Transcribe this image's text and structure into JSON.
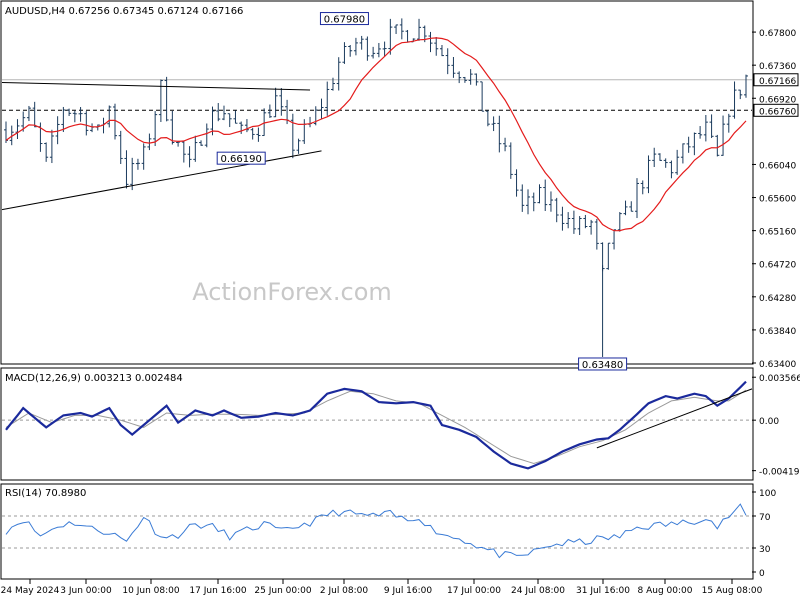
{
  "chart_data": [
    {
      "type": "candlestick",
      "panel": "price",
      "title": "AUDUSD,H4  0.67256 0.67345 0.67124 0.67166",
      "watermark": "ActionForex.com",
      "ylim": [
        0.634,
        0.682
      ],
      "yticks": [
        "0.67800",
        "0.67360",
        "0.66920",
        "0.66040",
        "0.65600",
        "0.65160",
        "0.64720",
        "0.64280",
        "0.63840",
        "0.63400"
      ],
      "last_price_label": "0.67166",
      "last_price": 0.67166,
      "level_line_label": "0.66760",
      "level_line": 0.6676,
      "annotations": [
        {
          "text": "0.67980",
          "x": 59,
          "y": 0.6798
        },
        {
          "text": "0.66190",
          "x": 41,
          "y": 0.6619
        },
        {
          "text": "0.63480",
          "x": 104,
          "y": 0.6348
        }
      ],
      "moving_average": {
        "name": "",
        "color": "#e41c1c"
      },
      "trendlines": [
        {
          "p1": [
            0,
            0.6713
          ],
          "p2": [
            53,
            0.6703
          ]
        },
        {
          "p1": [
            0,
            0.6544
          ],
          "p2": [
            55,
            0.6622
          ]
        }
      ],
      "price_path": [
        [
          0,
          0.665
        ],
        [
          4,
          0.667
        ],
        [
          7,
          0.6605
        ],
        [
          10,
          0.668
        ],
        [
          13,
          0.667
        ],
        [
          16,
          0.6645
        ],
        [
          18,
          0.668
        ],
        [
          21,
          0.6585
        ],
        [
          24,
          0.6615
        ],
        [
          27,
          0.6705
        ],
        [
          29,
          0.6645
        ],
        [
          32,
          0.66
        ],
        [
          35,
          0.6665
        ],
        [
          38,
          0.6675
        ],
        [
          41,
          0.6645
        ],
        [
          44,
          0.6655
        ],
        [
          47,
          0.669
        ],
        [
          50,
          0.663
        ],
        [
          53,
          0.6655
        ],
        [
          56,
          0.67
        ],
        [
          58,
          0.674
        ],
        [
          61,
          0.6765
        ],
        [
          64,
          0.676
        ],
        [
          67,
          0.6775
        ],
        [
          70,
          0.678
        ],
        [
          73,
          0.6785
        ],
        [
          75,
          0.676
        ],
        [
          78,
          0.6735
        ],
        [
          81,
          0.672
        ],
        [
          84,
          0.666
        ],
        [
          87,
          0.662
        ],
        [
          90,
          0.6545
        ],
        [
          93,
          0.656
        ],
        [
          96,
          0.6545
        ],
        [
          99,
          0.652
        ],
        [
          102,
          0.6525
        ],
        [
          104,
          0.6455
        ],
        [
          106,
          0.652
        ],
        [
          108,
          0.6535
        ],
        [
          110,
          0.657
        ],
        [
          113,
          0.661
        ],
        [
          116,
          0.66
        ],
        [
          119,
          0.663
        ],
        [
          122,
          0.665
        ],
        [
          124,
          0.661
        ],
        [
          126,
          0.668
        ],
        [
          128,
          0.6705
        ],
        [
          129,
          0.672
        ]
      ],
      "x_labels": [
        "24 May 2024",
        "3 Jun 00:00",
        "10 Jun 08:00",
        "17 Jun 16:00",
        "25 Jun 00:00",
        "2 Jul 08:00",
        "9 Jul 16:00",
        "17 Jul 00:00",
        "24 Jul 08:00",
        "31 Jul 16:00",
        "8 Aug 00:00",
        "15 Aug 08:00"
      ]
    },
    {
      "type": "line",
      "panel": "macd",
      "title": "MACD(12,26,9)  0.003213  0.002484",
      "ylim": [
        -0.0048,
        0.004
      ],
      "yticks": [
        "0.003566",
        "0.00",
        "-0.00419"
      ],
      "series": [
        {
          "name": "",
          "color": "#1b2a9c",
          "values": [
            [
              0,
              -0.0008
            ],
            [
              3,
              0.001
            ],
            [
              7,
              -0.0006
            ],
            [
              10,
              0.0004
            ],
            [
              13,
              0.0006
            ],
            [
              15,
              0.0003
            ],
            [
              18,
              0.001
            ],
            [
              20,
              -0.0004
            ],
            [
              22,
              -0.0012
            ],
            [
              25,
              0.0
            ],
            [
              28,
              0.0012
            ],
            [
              30,
              -0.0002
            ],
            [
              33,
              0.0008
            ],
            [
              36,
              0.0004
            ],
            [
              38,
              0.0008
            ],
            [
              41,
              0.0002
            ],
            [
              44,
              0.0003
            ],
            [
              47,
              0.0006
            ],
            [
              50,
              0.0004
            ],
            [
              53,
              0.0008
            ],
            [
              56,
              0.0022
            ],
            [
              59,
              0.0026
            ],
            [
              62,
              0.0024
            ],
            [
              65,
              0.0015
            ],
            [
              68,
              0.0014
            ],
            [
              71,
              0.0015
            ],
            [
              74,
              0.0012
            ],
            [
              76,
              -0.0004
            ],
            [
              79,
              -0.0008
            ],
            [
              82,
              -0.0014
            ],
            [
              85,
              -0.0026
            ],
            [
              88,
              -0.0036
            ],
            [
              91,
              -0.004
            ],
            [
              94,
              -0.0034
            ],
            [
              97,
              -0.0026
            ],
            [
              100,
              -0.002
            ],
            [
              103,
              -0.0016
            ],
            [
              105,
              -0.0015
            ],
            [
              107,
              -0.0008
            ],
            [
              110,
              0.0005
            ],
            [
              112,
              0.0014
            ],
            [
              115,
              0.002
            ],
            [
              117,
              0.0018
            ],
            [
              120,
              0.0022
            ],
            [
              122,
              0.002
            ],
            [
              124,
              0.0012
            ],
            [
              126,
              0.0018
            ],
            [
              129,
              0.0032
            ]
          ]
        },
        {
          "name": "",
          "color": "#9a9a9a",
          "values": [
            [
              0,
              -0.0006
            ],
            [
              4,
              0.0006
            ],
            [
              8,
              -0.0002
            ],
            [
              12,
              0.0004
            ],
            [
              16,
              0.0004
            ],
            [
              20,
              0.0
            ],
            [
              24,
              -0.0006
            ],
            [
              28,
              0.0006
            ],
            [
              32,
              0.0004
            ],
            [
              36,
              0.0005
            ],
            [
              40,
              0.0005
            ],
            [
              44,
              0.0004
            ],
            [
              48,
              0.0005
            ],
            [
              52,
              0.0006
            ],
            [
              56,
              0.0016
            ],
            [
              60,
              0.0024
            ],
            [
              64,
              0.0022
            ],
            [
              68,
              0.0016
            ],
            [
              72,
              0.0014
            ],
            [
              76,
              0.0004
            ],
            [
              80,
              -0.0006
            ],
            [
              84,
              -0.0018
            ],
            [
              88,
              -0.003
            ],
            [
              92,
              -0.0036
            ],
            [
              96,
              -0.003
            ],
            [
              100,
              -0.0022
            ],
            [
              104,
              -0.0017
            ],
            [
              108,
              -0.0008
            ],
            [
              112,
              0.0006
            ],
            [
              116,
              0.0016
            ],
            [
              120,
              0.0019
            ],
            [
              124,
              0.0016
            ],
            [
              126,
              0.0016
            ],
            [
              129,
              0.0025
            ]
          ]
        }
      ],
      "trendline": {
        "p1": [
          103,
          -0.0023
        ],
        "p2": [
          129,
          0.0026
        ]
      }
    },
    {
      "type": "line",
      "panel": "rsi",
      "title": "RSI(14) 70.8980",
      "ylim": [
        0,
        100
      ],
      "yticks": [
        "100",
        "70",
        "30",
        "0"
      ],
      "series": [
        {
          "name": "",
          "color": "#3a7bd5",
          "values": [
            [
              0,
              52
            ],
            [
              3,
              66
            ],
            [
              6,
              45
            ],
            [
              9,
              58
            ],
            [
              12,
              62
            ],
            [
              15,
              54
            ],
            [
              18,
              50
            ],
            [
              21,
              38
            ],
            [
              24,
              70
            ],
            [
              26,
              52
            ],
            [
              28,
              42
            ],
            [
              30,
              47
            ],
            [
              33,
              60
            ],
            [
              36,
              56
            ],
            [
              39,
              45
            ],
            [
              42,
              52
            ],
            [
              45,
              60
            ],
            [
              48,
              50
            ],
            [
              51,
              58
            ],
            [
              54,
              64
            ],
            [
              56,
              72
            ],
            [
              58,
              75
            ],
            [
              61,
              72
            ],
            [
              64,
              70
            ],
            [
              67,
              72
            ],
            [
              70,
              64
            ],
            [
              72,
              70
            ],
            [
              74,
              55
            ],
            [
              77,
              45
            ],
            [
              80,
              40
            ],
            [
              83,
              30
            ],
            [
              86,
              22
            ],
            [
              89,
              18
            ],
            [
              92,
              25
            ],
            [
              95,
              34
            ],
            [
              98,
              36
            ],
            [
              101,
              38
            ],
            [
              104,
              42
            ],
            [
              107,
              44
            ],
            [
              110,
              56
            ],
            [
              113,
              58
            ],
            [
              116,
              60
            ],
            [
              119,
              62
            ],
            [
              122,
              70
            ],
            [
              124,
              56
            ],
            [
              126,
              70
            ],
            [
              128,
              80
            ],
            [
              129,
              71
            ]
          ]
        }
      ]
    }
  ]
}
